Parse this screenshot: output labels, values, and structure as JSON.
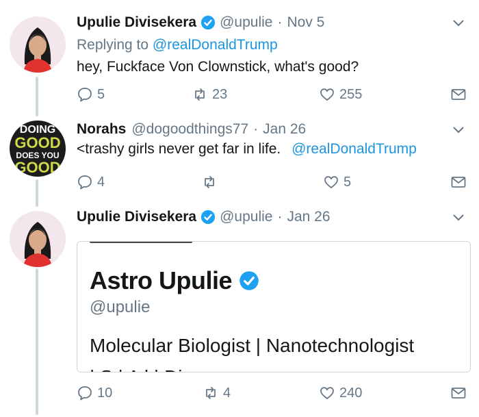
{
  "tweets": [
    {
      "name": "Upulie Divisekera",
      "handle": "@upulie",
      "date": "Nov 5",
      "replying_label": "Replying to",
      "replying_to": "@realDonaldTrump",
      "text": "hey, Fuckface Von Clownstick, what's good?",
      "replies": "5",
      "retweets": "23",
      "likes": "255"
    },
    {
      "name": "Norahs",
      "handle": "@dogoodthings77",
      "date": "Jan 26",
      "text": "<trashy girls never get far in life.",
      "mention": "@realDonaldTrump",
      "replies": "4",
      "retweets": "",
      "likes": "5",
      "avatar_text": [
        "DOING",
        "GOOD",
        "DOES YOU",
        "GOOD"
      ]
    },
    {
      "name": "Upulie Divisekera",
      "handle": "@upulie",
      "date": "Jan 26",
      "card": {
        "name": "Astro Upulie",
        "handle": "@upulie",
        "bio": "Molecular Biologist | Nanotechnologist",
        "cut": "| S        | A              l    | Di"
      },
      "replies": "10",
      "retweets": "4",
      "likes": "240"
    }
  ],
  "separator": "·",
  "colors": {
    "link": "#1b95e0",
    "muted": "#657786",
    "verified": "#1da1f2",
    "thread_line": "#ccd6dd"
  }
}
